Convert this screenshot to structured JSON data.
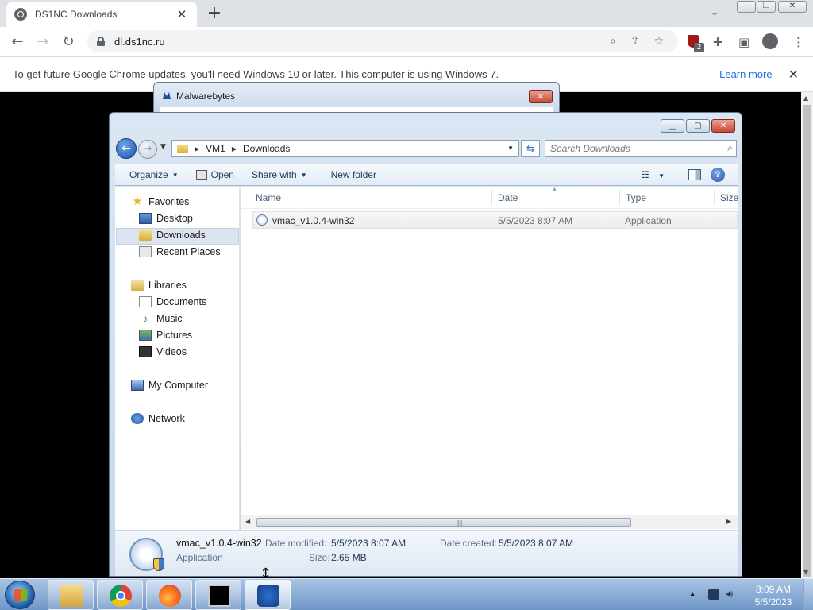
{
  "browser": {
    "tab_title": "DS1NC Downloads",
    "url": "dl.ds1nc.ru",
    "extension_badge": "2",
    "infobar_message": "To get future Google Chrome updates, you'll need Windows 10 or later. This computer is using Windows 7.",
    "infobar_link": "Learn more"
  },
  "malwarebytes": {
    "title": "Malwarebytes"
  },
  "explorer": {
    "breadcrumb": [
      "VM1",
      "Downloads"
    ],
    "search_placeholder": "Search Downloads",
    "commands": {
      "organize": "Organize",
      "open": "Open",
      "share_with": "Share with",
      "new_folder": "New folder"
    },
    "nav": {
      "favorites": "Favorites",
      "desktop": "Desktop",
      "downloads": "Downloads",
      "recent_places": "Recent Places",
      "libraries": "Libraries",
      "documents": "Documents",
      "music": "Music",
      "pictures": "Pictures",
      "videos": "Videos",
      "my_computer": "My Computer",
      "network": "Network"
    },
    "columns": {
      "name": "Name",
      "date": "Date",
      "type": "Type",
      "size": "Size"
    },
    "files": [
      {
        "name": "vmac_v1.0.4-win32",
        "date": "5/5/2023 8:07 AM",
        "type": "Application"
      }
    ],
    "details": {
      "name": "vmac_v1.0.4-win32",
      "type": "Application",
      "date_modified_label": "Date modified:",
      "date_modified": "5/5/2023 8:07 AM",
      "date_created_label": "Date created:",
      "date_created": "5/5/2023 8:07 AM",
      "size_label": "Size:",
      "size": "2.65 MB"
    }
  },
  "taskbar": {
    "time": "8:09 AM",
    "date": "5/5/2023"
  },
  "colors": {
    "chrome_tabstrip": "#dee1e6",
    "link_blue": "#1a73e8",
    "taskbar": "#6f96c6"
  }
}
